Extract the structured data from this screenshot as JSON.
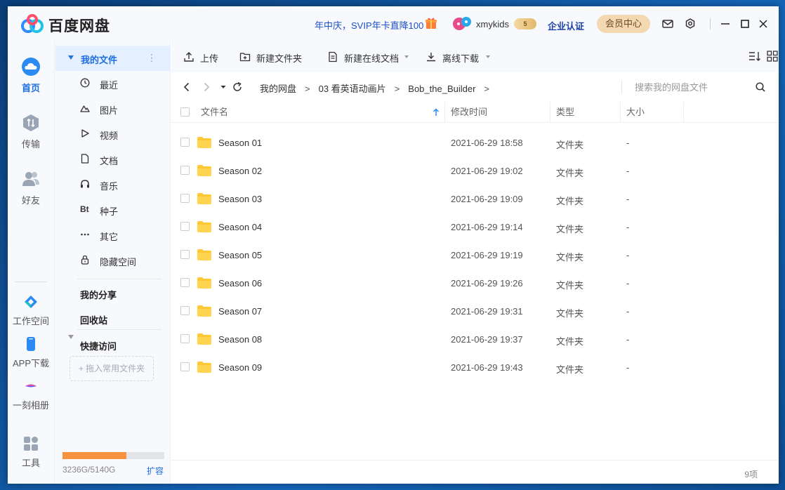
{
  "titlebar": {
    "app_title": "百度网盘",
    "promo": "年中庆，SVIP年卡直降100",
    "username": "xmykids",
    "svip_level": "5",
    "enterprise": "企业认证",
    "vip_center": "会员中心"
  },
  "rail": {
    "home": "首页",
    "transfer": "传输",
    "friends": "好友",
    "workspace": "工作空间",
    "app_download": "APP下载",
    "album": "一刻相册",
    "tools": "工具"
  },
  "sidebar": {
    "my_files": "我的文件",
    "items": [
      {
        "label": "最近",
        "icon": "clock-icon"
      },
      {
        "label": "图片",
        "icon": "image-icon"
      },
      {
        "label": "视频",
        "icon": "video-icon"
      },
      {
        "label": "文档",
        "icon": "document-icon"
      },
      {
        "label": "音乐",
        "icon": "music-icon"
      },
      {
        "label": "种子",
        "icon": "torrent-icon"
      },
      {
        "label": "其它",
        "icon": "more-icon"
      },
      {
        "label": "隐藏空间",
        "icon": "lock-icon"
      }
    ],
    "my_shares": "我的分享",
    "recycle_bin": "回收站",
    "quick_access": "快捷访问",
    "drop_hint": "+ 拖入常用文件夹",
    "storage_used_fraction": 0.629,
    "storage_text": "3236G/5140G",
    "expand": "扩容"
  },
  "toolbar": {
    "upload": "上传",
    "new_folder": "新建文件夹",
    "new_online_doc": "新建在线文档",
    "offline_download": "离线下载"
  },
  "navbar": {
    "crumbs": [
      "我的网盘",
      "03 看英语动画片",
      "Bob_the_Builder"
    ],
    "crumb_sep": ">",
    "search_placeholder": "搜索我的网盘文件"
  },
  "table": {
    "headers": {
      "name": "文件名",
      "modified": "修改时间",
      "type": "类型",
      "size": "大小"
    },
    "rows": [
      {
        "name": "Season 01",
        "modified": "2021-06-29 18:58",
        "type": "文件夹",
        "size": "-"
      },
      {
        "name": "Season 02",
        "modified": "2021-06-29 19:02",
        "type": "文件夹",
        "size": "-"
      },
      {
        "name": "Season 03",
        "modified": "2021-06-29 19:09",
        "type": "文件夹",
        "size": "-"
      },
      {
        "name": "Season 04",
        "modified": "2021-06-29 19:14",
        "type": "文件夹",
        "size": "-"
      },
      {
        "name": "Season 05",
        "modified": "2021-06-29 19:19",
        "type": "文件夹",
        "size": "-"
      },
      {
        "name": "Season 06",
        "modified": "2021-06-29 19:26",
        "type": "文件夹",
        "size": "-"
      },
      {
        "name": "Season 07",
        "modified": "2021-06-29 19:31",
        "type": "文件夹",
        "size": "-"
      },
      {
        "name": "Season 08",
        "modified": "2021-06-29 19:37",
        "type": "文件夹",
        "size": "-"
      },
      {
        "name": "Season 09",
        "modified": "2021-06-29 19:43",
        "type": "文件夹",
        "size": "-"
      }
    ],
    "count": "9项"
  },
  "colors": {
    "accent": "#1d6ee0",
    "folder": "#ffc933",
    "storage_fill": "#f8923f",
    "promo": "#2050c8"
  }
}
